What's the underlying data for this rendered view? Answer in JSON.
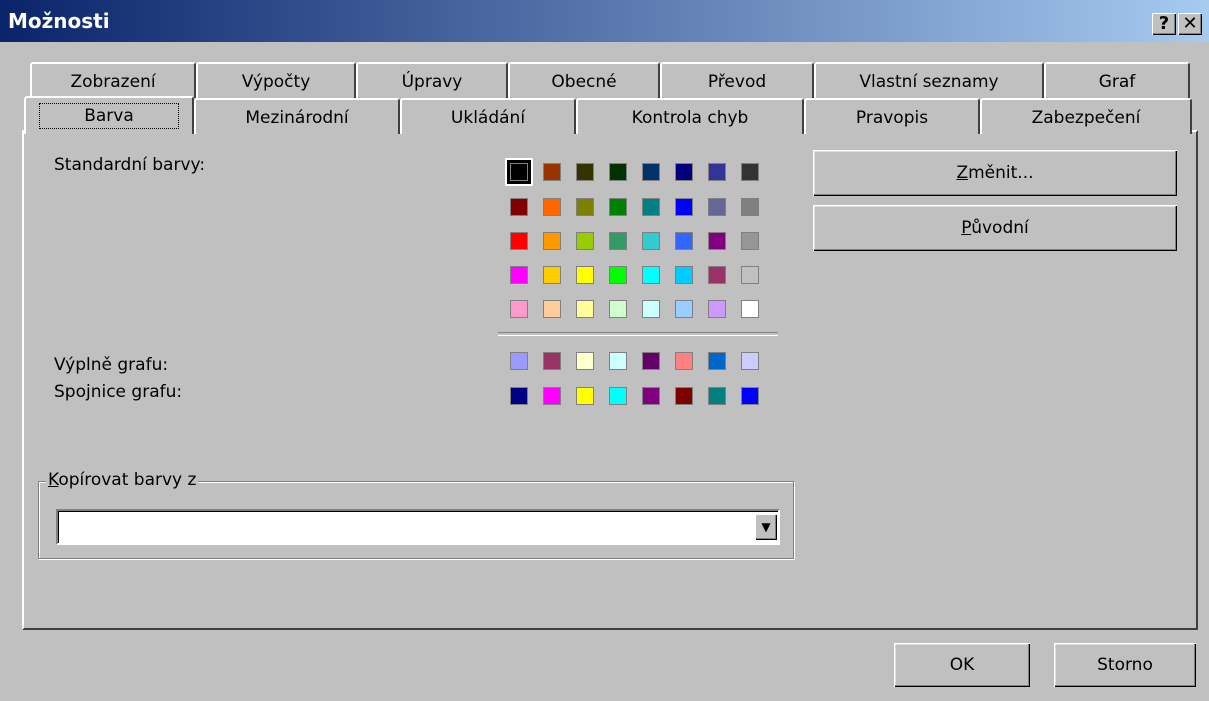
{
  "window": {
    "title": "Možnosti",
    "help_glyph": "?",
    "close_glyph": "✕"
  },
  "tabs_back": [
    "Zobrazení",
    "Výpočty",
    "Úpravy",
    "Obecné",
    "Převod",
    "Vlastní seznamy",
    "Graf"
  ],
  "tabs_front": [
    "Barva",
    "Mezinárodní",
    "Ukládání",
    "Kontrola chyb",
    "Pravopis",
    "Zabezpečení"
  ],
  "active_tab": "Barva",
  "labels": {
    "standard": "Standardní barvy:",
    "fills": "Výplně grafu:",
    "lines": "Spojnice grafu:"
  },
  "standard_colors": [
    [
      "#000000",
      "#993300",
      "#333300",
      "#003300",
      "#003366",
      "#000080",
      "#333399",
      "#333333"
    ],
    [
      "#800000",
      "#ff6600",
      "#808000",
      "#008000",
      "#008080",
      "#0000ff",
      "#666699",
      "#808080"
    ],
    [
      "#ff0000",
      "#ff9900",
      "#99cc00",
      "#339966",
      "#33cccc",
      "#3366ff",
      "#800080",
      "#969696"
    ],
    [
      "#ff00ff",
      "#ffcc00",
      "#ffff00",
      "#00ff00",
      "#00ffff",
      "#00ccff",
      "#993366",
      "#c0c0c0"
    ],
    [
      "#ff99cc",
      "#ffcc99",
      "#ffff99",
      "#ccffcc",
      "#ccffff",
      "#99ccff",
      "#cc99ff",
      "#ffffff"
    ]
  ],
  "chart_fill_colors": [
    "#9999ff",
    "#993366",
    "#ffffcc",
    "#ccffff",
    "#660066",
    "#ff8080",
    "#0066cc",
    "#ccccff"
  ],
  "chart_line_colors": [
    "#000080",
    "#ff00ff",
    "#ffff00",
    "#00ffff",
    "#800080",
    "#800000",
    "#008080",
    "#0000ff"
  ],
  "buttons": {
    "zmenit": "Změnit...",
    "puvodni": "Původní",
    "ok": "OK",
    "storno": "Storno"
  },
  "copy_group": {
    "label": "Kopírovat barvy z",
    "value": ""
  }
}
